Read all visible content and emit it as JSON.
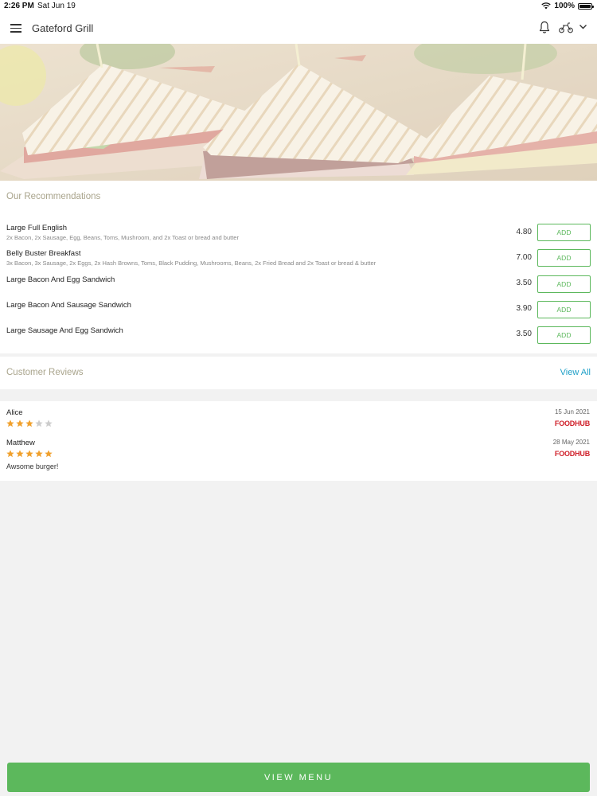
{
  "status_bar": {
    "time": "2:26 PM",
    "date": "Sat Jun 19",
    "battery": "100%",
    "battery_level": 1.0
  },
  "header": {
    "title": "Gateford Grill",
    "icons": [
      "menu-icon",
      "bell-icon",
      "delivery-icon",
      "chevron-down-icon"
    ]
  },
  "colors": {
    "accent": "#5cb85c",
    "link": "#1fa0c8",
    "section_title": "#a9a48c",
    "star": "#f0a02c",
    "star_empty": "#cccccc",
    "brand_red": "#d0202a"
  },
  "recommendations": {
    "title": "Our Recommendations",
    "items": [
      {
        "name": "Large Full English",
        "description": "2x Bacon, 2x Sausage, Egg, Beans, Toms, Mushroom, and 2x Toast or bread and butter",
        "price": "4.80",
        "button": "ADD"
      },
      {
        "name": "Belly Buster Breakfast",
        "description": "3x Bacon, 3x Sausage, 2x Eggs, 2x Hash Browns, Toms, Black Pudding, Mushrooms, Beans, 2x Fried Bread and 2x Toast or bread & butter",
        "price": "7.00",
        "button": "ADD"
      },
      {
        "name": "Large Bacon And Egg Sandwich",
        "description": "",
        "price": "3.50",
        "button": "ADD"
      },
      {
        "name": "Large Bacon And Sausage Sandwich",
        "description": "",
        "price": "3.90",
        "button": "ADD"
      },
      {
        "name": "Large Sausage And Egg Sandwich",
        "description": "",
        "price": "3.50",
        "button": "ADD"
      }
    ]
  },
  "reviews": {
    "title": "Customer Reviews",
    "view_all": "View All",
    "items": [
      {
        "name": "Alice",
        "rating": 3,
        "max_rating": 5,
        "date": "15 Jun 2021",
        "source": "FOODHUB",
        "comment": ""
      },
      {
        "name": "Matthew",
        "rating": 5,
        "max_rating": 5,
        "date": "28 May 2021",
        "source": "FOODHUB",
        "comment": "Awsome burger!"
      }
    ]
  },
  "footer": {
    "view_menu": "VIEW MENU"
  }
}
